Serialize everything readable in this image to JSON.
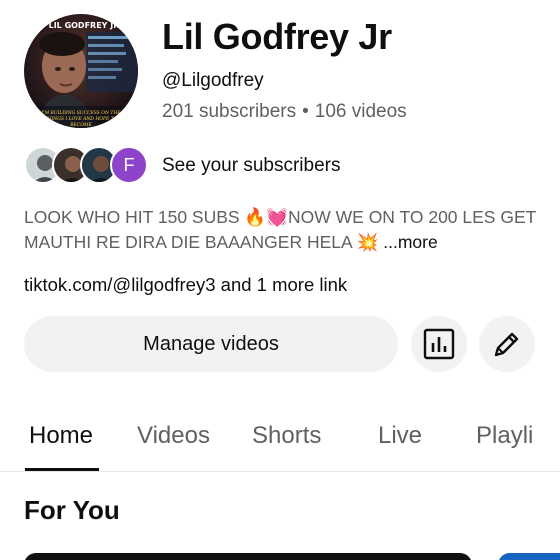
{
  "channel": {
    "name": "Lil Godfrey Jr",
    "handle": "@Lilgodfrey",
    "subscribers": "201 subscribers",
    "separator": "•",
    "videos": "106 videos",
    "avatar_caption_top": "LIL GODFREY JR",
    "avatar_caption_bottom": "I'M BUILDING SUCCESS ON THE THINGS I LOVE AND HOPE TO BECOME"
  },
  "subscribers_preview": {
    "link_label": "See your subscribers",
    "letter_avatar": "F",
    "colors": {
      "letter_avatar_bg": "#8e44c8"
    }
  },
  "description": {
    "text": "LOOK WHO HIT 150 SUBS 🔥💓NOW WE ON TO 200 LES GET MAUTHI RE DIRA DIE BAAANGER HELA 💥",
    "more_label": "...more"
  },
  "links": {
    "text": "tiktok.com/@lilgodfrey3 and 1 more link"
  },
  "actions": {
    "manage_videos": "Manage videos",
    "analytics_icon": "bar-chart-icon",
    "edit_icon": "pencil-icon"
  },
  "tabs": [
    {
      "label": "Home",
      "active": true
    },
    {
      "label": "Videos",
      "active": false
    },
    {
      "label": "Shorts",
      "active": false
    },
    {
      "label": "Live",
      "active": false
    },
    {
      "label": "Playli",
      "active": false
    }
  ],
  "section": {
    "title": "For You"
  },
  "colors": {
    "text_primary": "#0f0f0f",
    "text_secondary": "#606060",
    "button_bg": "#f2f2f2",
    "divider": "#e5e5e5"
  }
}
